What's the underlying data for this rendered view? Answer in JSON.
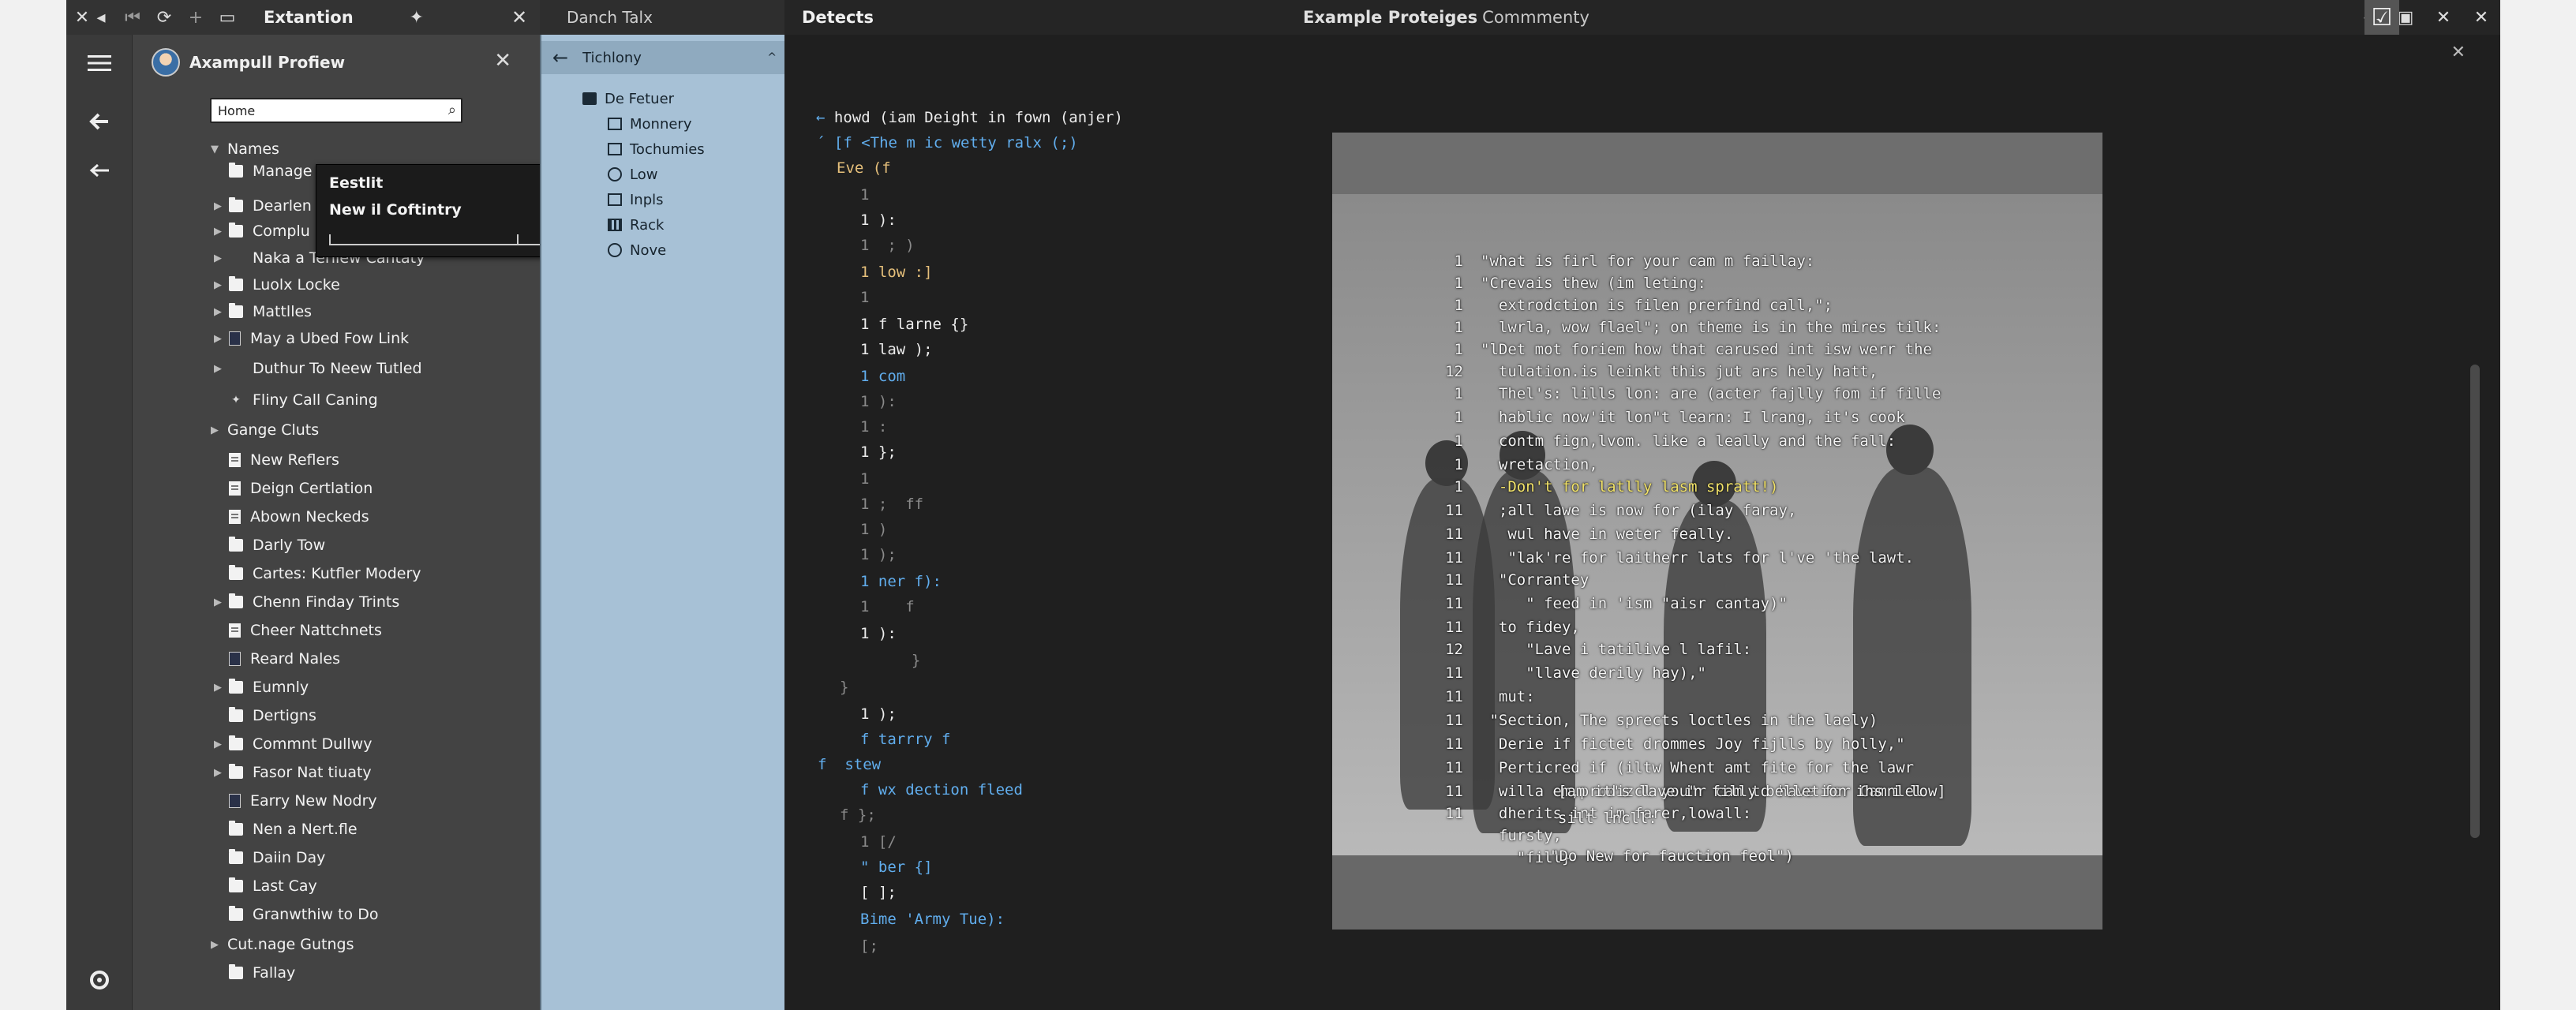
{
  "topbar": {
    "left_title": "Extantion",
    "mid_title": "Danch Talx",
    "right_title": "Detects",
    "center_title_bold": "Example Proteiges",
    "center_title_sub": "Commmenty"
  },
  "sidebar": {
    "title": "Axampull Profiew",
    "search_value": "Home",
    "tree": [
      {
        "label": "Names",
        "kind": "group",
        "expanded": true
      },
      {
        "label": "Manage",
        "kind": "folder"
      },
      {
        "label": "Dearlen",
        "kind": "folder",
        "arrow": true
      },
      {
        "label": "Complu",
        "kind": "folder",
        "arrow": true
      },
      {
        "label": "Naka a Terllew Cantaty",
        "kind": "none",
        "arrow": true
      },
      {
        "label": "Luolx Locke",
        "kind": "folder",
        "arrow": true
      },
      {
        "label": "Mattlles",
        "kind": "folder",
        "arrow": true
      },
      {
        "label": "May a Ubed Fow Link",
        "kind": "book",
        "arrow": true
      },
      {
        "label": "Duthur To Neew Tutled",
        "kind": "none",
        "arrow": true
      },
      {
        "label": "Fliny Call Caning",
        "kind": "star"
      },
      {
        "label": "Gange Cluts",
        "kind": "group"
      },
      {
        "label": "New Reflers",
        "kind": "file"
      },
      {
        "label": "Deign Certlation",
        "kind": "file"
      },
      {
        "label": "Abown Neckeds",
        "kind": "file"
      },
      {
        "label": "Darly Tow",
        "kind": "folder"
      },
      {
        "label": "Cartes: Kutfler Modery",
        "kind": "folder"
      },
      {
        "label": "Chenn Finday Trints",
        "kind": "folder",
        "arrow": true
      },
      {
        "label": "Cheer Nattchnets",
        "kind": "file"
      },
      {
        "label": "Reard Nales",
        "kind": "book"
      },
      {
        "label": "Eumnly",
        "kind": "folder",
        "arrow": true
      },
      {
        "label": "Dertigns",
        "kind": "folder"
      },
      {
        "label": "Commnt Dullwy",
        "kind": "folder",
        "arrow": true
      },
      {
        "label": "Fasor Nat tiuaty",
        "kind": "folder",
        "arrow": true
      },
      {
        "label": "Earry New Nodry",
        "kind": "book"
      },
      {
        "label": "Nen a Nert.fle",
        "kind": "folder"
      },
      {
        "label": "Daiin Day",
        "kind": "folder"
      },
      {
        "label": "Last Cay",
        "kind": "folder"
      },
      {
        "label": "Granwthiw to Do",
        "kind": "folder"
      },
      {
        "label": "Cut.nage Gutngs",
        "kind": "group"
      },
      {
        "label": "Fallay",
        "kind": "folder"
      }
    ]
  },
  "popup": {
    "title": "Eestlit",
    "subtitle": "New il Coftintry"
  },
  "explorer": {
    "header": "Tichlony",
    "items": [
      {
        "label": "De Fetuer",
        "icon": "f"
      },
      {
        "label": "Monnery",
        "icon": "o"
      },
      {
        "label": "Tochumies",
        "icon": "o"
      },
      {
        "label": "Low",
        "icon": "c"
      },
      {
        "label": "Inpls",
        "icon": "o"
      },
      {
        "label": "Rack",
        "icon": "g"
      },
      {
        "label": "Nove",
        "icon": "c"
      }
    ]
  },
  "code_lines": [
    {
      "text": "howd (iam Deight in fown (anjer)",
      "cls": "wt",
      "pre": "← "
    },
    {
      "text": "[f <The m ic wetty ralx (;)",
      "cls": "bl",
      "pre": "´ "
    },
    {
      "text": "Eve (f",
      "cls": "kw",
      "pre": ""
    },
    {
      "text": "1",
      "cls": "ln",
      "pre": ""
    },
    {
      "text": "1 ):",
      "cls": "wt",
      "pre": ""
    },
    {
      "text": "1  ; )",
      "cls": "ln",
      "pre": ""
    },
    {
      "text": "1 low :]",
      "cls": "kw",
      "pre": ""
    },
    {
      "text": "1",
      "cls": "ln",
      "pre": ""
    },
    {
      "text": "1 f larne {}",
      "cls": "wt",
      "pre": ""
    },
    {
      "text": "1 law );",
      "cls": "wt",
      "pre": ""
    },
    {
      "text": "1 com",
      "cls": "bl",
      "pre": ""
    },
    {
      "text": "1 ):",
      "cls": "ln",
      "pre": ""
    },
    {
      "text": "1 :",
      "cls": "ln",
      "pre": ""
    },
    {
      "text": "1 };",
      "cls": "wt",
      "pre": ""
    },
    {
      "text": "1",
      "cls": "ln",
      "pre": ""
    },
    {
      "text": "1 ;  ff",
      "cls": "ln",
      "pre": ""
    },
    {
      "text": "1 )",
      "cls": "ln",
      "pre": ""
    },
    {
      "text": "1 );",
      "cls": "ln",
      "pre": ""
    },
    {
      "text": "1 ner f):",
      "cls": "bl",
      "pre": ""
    },
    {
      "text": "1    f",
      "cls": "ln",
      "pre": ""
    },
    {
      "text": "1 ):",
      "cls": "wt",
      "pre": ""
    },
    {
      "text": "  }",
      "cls": "ln",
      "pre": ""
    },
    {
      "text": "}",
      "cls": "ln",
      "pre": ""
    },
    {
      "text": "1 );",
      "cls": "wt",
      "pre": ""
    },
    {
      "text": "f tarrry f",
      "cls": "bl",
      "pre": ""
    },
    {
      "text": "stew",
      "cls": "bl",
      "pre": "f  "
    },
    {
      "text": "f wx dection fleed",
      "cls": "bl",
      "pre": ""
    },
    {
      "text": "f };",
      "cls": "ln",
      "pre": ""
    },
    {
      "text": "1 [/",
      "cls": "ln",
      "pre": ""
    },
    {
      "text": "\" ber {]",
      "cls": "bl",
      "pre": ""
    },
    {
      "text": "[ ];",
      "cls": "wt",
      "pre": ""
    },
    {
      "text": "Bime 'Army Tue):",
      "cls": "bl",
      "pre": ""
    },
    {
      "text": "[;",
      "cls": "ln",
      "pre": ""
    }
  ],
  "media_lines": [
    {
      "n": "1",
      "t": "\"what is firl for your cam m faillay:"
    },
    {
      "n": "1",
      "t": "\"Crevais thew (im leting:"
    },
    {
      "n": "1",
      "t": "  extrodction is filen prerfind call,\";"
    },
    {
      "n": "1",
      "t": "  lwrla, wow flael\"; on theme is in the mires tilk:"
    },
    {
      "n": "1",
      "t": "\"lDet mot foriem how that carused int isw werr the"
    },
    {
      "n": "12",
      "t": "  tulation.is leinkt this jut ars hely hatt,"
    },
    {
      "n": "1",
      "t": "  Thel's: lills lon: are (acter fajlly fom if fille"
    },
    {
      "n": "1",
      "t": "  hablic now'it lon\"t learn: I lrang, it's cook"
    },
    {
      "n": "1",
      "t": "  contm fign,lvom. like a leally and the fall:"
    },
    {
      "n": "1",
      "t": "  wretaction,"
    },
    {
      "n": "1",
      "t": "  -Don't for latlly lasm spratt!)",
      "y": true
    },
    {
      "n": "11",
      "t": "  ;all lawe is now for (ilay faray,"
    },
    {
      "n": "11",
      "t": "   wul have in weter feally."
    },
    {
      "n": "11",
      "t": "   \"lak're for laitherr lats for l've 'the lawt."
    },
    {
      "n": "11",
      "t": "  \"Corrantey"
    },
    {
      "n": "11",
      "t": "     \" feed in 'ism \"aisr cantay)\""
    },
    {
      "n": "11",
      "t": "  to fidey,"
    },
    {
      "n": "12",
      "t": "     \"Lave i tatilive l lafil:"
    },
    {
      "n": "11",
      "t": "     \"llave derily hay),\""
    },
    {
      "n": "11",
      "t": "  mut:"
    },
    {
      "n": "11",
      "t": " \"Section, The sprects loctles in the laely)"
    },
    {
      "n": "11",
      "t": "  Derie if fictet drommes Joy fijlls by holly,\""
    },
    {
      "n": "11",
      "t": "  Perticred if (iltw Whent amt fite for the lawr"
    },
    {
      "n": "11",
      "t": "  willa em,prodizcl you\"r cam to have for Camnlel"
    },
    {
      "n": "11",
      "t": "  dherits int im farer,lowall:"
    },
    {
      "n": "",
      "t": "  fursty,"
    },
    {
      "n": "",
      "t": "    \"fill}"
    }
  ],
  "media_bottom_lines": [
    "[am it's lave in filly belletion ihs i low]",
    "silt lncll:",
    "\"Do New for fauction feol\")"
  ],
  "colors": {
    "accent_yellow": "#e6c07b",
    "accent_blue": "#61aeee",
    "explorer_bg": "#a7c1d6"
  }
}
